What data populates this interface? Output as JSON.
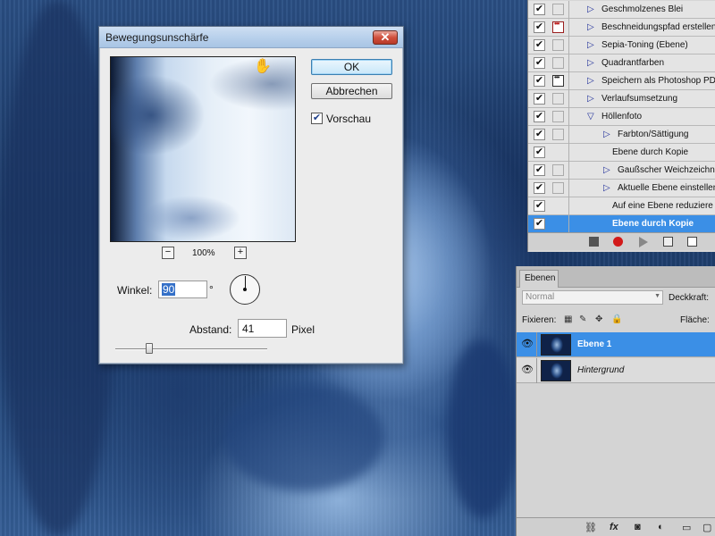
{
  "dialog": {
    "title": "Bewegungsunschärfe",
    "close_label": "✕",
    "ok_label": "OK",
    "cancel_label": "Abbrechen",
    "preview_label": "Vorschau",
    "preview_checked": true,
    "zoom_out_label": "−",
    "zoom_in_label": "+",
    "zoom_level": "100%",
    "angle_label": "Winkel:",
    "angle_value": "90",
    "angle_unit": "°",
    "distance_label": "Abstand:",
    "distance_value": "41",
    "distance_unit": "Pixel"
  },
  "actions": {
    "items": [
      {
        "label": "Geschmolzenes Blei",
        "checked": true,
        "dialog": "none",
        "indent": 0,
        "expanded": false
      },
      {
        "label": "Beschneidungspfad erstellen",
        "checked": true,
        "dialog": "red",
        "indent": 0,
        "expanded": false
      },
      {
        "label": "Sepia-Toning (Ebene)",
        "checked": true,
        "dialog": "none",
        "indent": 0,
        "expanded": false
      },
      {
        "label": "Quadrantfarben",
        "checked": true,
        "dialog": "none",
        "indent": 0,
        "expanded": false
      },
      {
        "label": "Speichern als Photoshop PD",
        "checked": true,
        "dialog": "dark",
        "indent": 0,
        "expanded": false
      },
      {
        "label": "Verlaufsumsetzung",
        "checked": true,
        "dialog": "none",
        "indent": 0,
        "expanded": false
      },
      {
        "label": "Höllenfoto",
        "checked": true,
        "dialog": "none",
        "indent": 0,
        "expanded": true
      },
      {
        "label": "Farbton/Sättigung",
        "checked": true,
        "dialog": "none",
        "indent": 1,
        "expanded": false
      },
      {
        "label": "Ebene durch Kopie",
        "checked": true,
        "dialog": "none",
        "indent": 1,
        "leaf": true
      },
      {
        "label": "Gaußscher Weichzeichne",
        "checked": true,
        "dialog": "none",
        "indent": 1,
        "expanded": false
      },
      {
        "label": "Aktuelle Ebene einstellen",
        "checked": true,
        "dialog": "none",
        "indent": 1,
        "expanded": false
      },
      {
        "label": "Auf eine Ebene reduziere",
        "checked": true,
        "dialog": "none",
        "indent": 1,
        "leaf": true
      },
      {
        "label": "Ebene durch Kopie",
        "checked": true,
        "dialog": "none",
        "indent": 1,
        "leaf": true,
        "selected": true
      }
    ]
  },
  "layers": {
    "tab_label": "Ebenen",
    "blend_mode": "Normal",
    "opacity_label": "Deckkraft:",
    "lock_label": "Fixieren:",
    "fill_label": "Fläche:",
    "items": [
      {
        "name": "Ebene 1",
        "visible": true,
        "selected": true
      },
      {
        "name": "Hintergrund",
        "visible": true,
        "selected": false,
        "italic": true
      }
    ]
  },
  "icons": {
    "check": "✔",
    "eye": "👁"
  },
  "colors": {
    "selection": "#3b8fe6",
    "record_red": "#d21a1a",
    "title_bar": "#b9d1ec"
  }
}
